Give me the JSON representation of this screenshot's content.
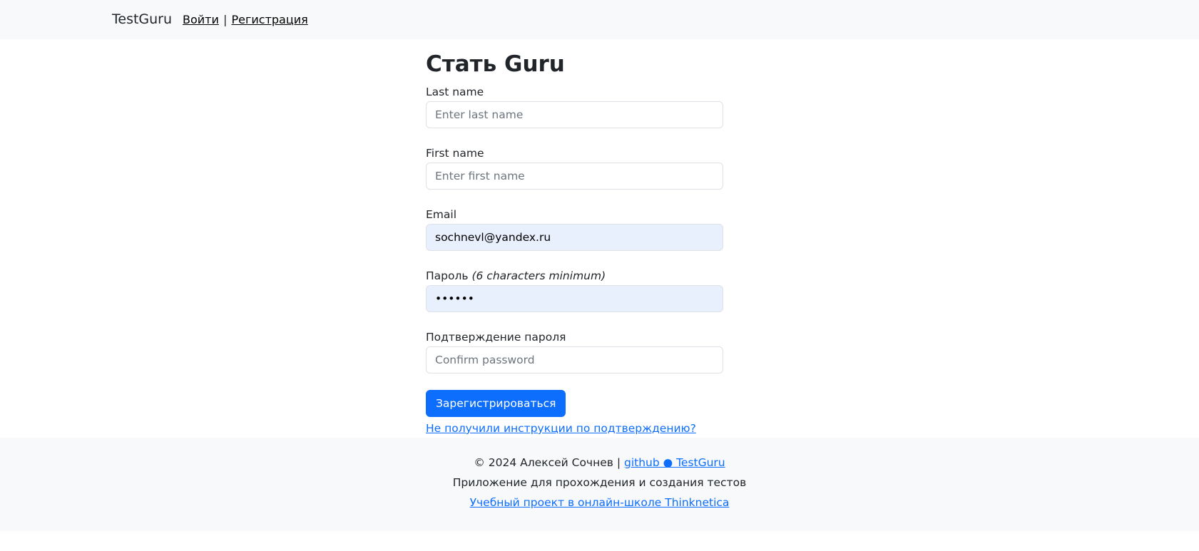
{
  "navbar": {
    "brand": "TestGuru",
    "login_label": "Войти",
    "separator": "|",
    "register_label": "Регистрация"
  },
  "form": {
    "title": "Стать Guru",
    "last_name": {
      "label": "Last name",
      "placeholder": "Enter last name",
      "value": ""
    },
    "first_name": {
      "label": "First name",
      "placeholder": "Enter first name",
      "value": ""
    },
    "email": {
      "label": "Email",
      "placeholder": "",
      "value": "sochnevl@yandex.ru"
    },
    "password": {
      "label": "Пароль",
      "hint": "(6 characters minimum)",
      "placeholder": "",
      "value": "123456"
    },
    "password_confirmation": {
      "label": "Подтверждение пароля",
      "placeholder": "Confirm password",
      "value": ""
    },
    "submit_label": "Зарегистрироваться",
    "confirmation_link": "Не получили инструкции по подтверждению?"
  },
  "footer": {
    "copyright": "© 2024 Алексей Сочнев |",
    "github_link": "github ● TestGuru",
    "tagline": "Приложение для прохождения и создания тестов",
    "school_link": "Учебный проект в онлайн-школе Thinknetica"
  },
  "colors": {
    "primary": "#0d6efd",
    "navbar_bg": "#f8f9fa",
    "autofill_bg": "#e8f0fe",
    "border": "#dee2e6"
  }
}
